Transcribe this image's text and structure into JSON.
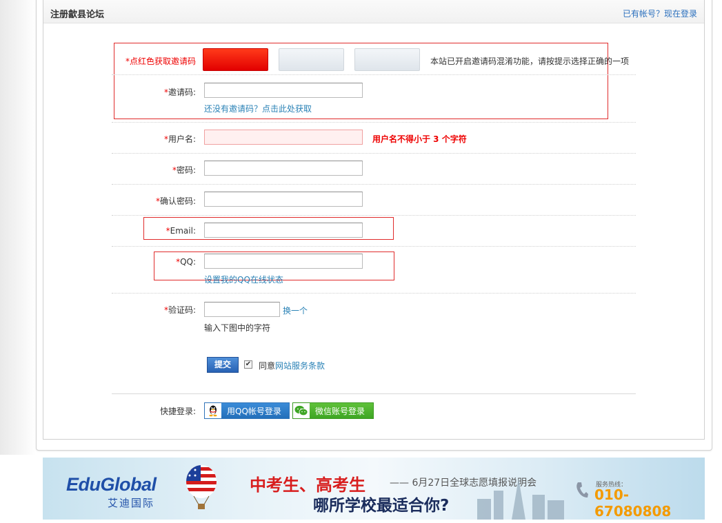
{
  "header": {
    "title": "注册歙县论坛",
    "login_link": "已有帐号？现在登录"
  },
  "invite": {
    "required_star": "*",
    "label": "点红色获取邀请码",
    "notice": "本站已开启邀请码混淆功能，请按提示选择正确的一项",
    "code_label": "邀请码:",
    "get_code_link": "还没有邀请码？点击此处获取"
  },
  "form": {
    "username_label": "用户名:",
    "username_error": "用户名不得小于 3 个字符",
    "password_label": "密码:",
    "confirm_password_label": "确认密码:",
    "email_label": "Email:",
    "qq_label": "QQ:",
    "qq_status_link": "设置我的QQ在线状态",
    "captcha_label": "验证码:",
    "captcha_refresh": "换一个",
    "captcha_hint": "输入下图中的字符",
    "submit_label": "提交",
    "agree_prefix": "同意",
    "agree_link": "网站服务条款",
    "agree_checked": true,
    "quick_login_label": "快捷登录:",
    "qq_login_label": "用QQ帐号登录",
    "wechat_login_label": "微信账号登录"
  },
  "banner": {
    "logo_text": "EduGlobal",
    "logo_cn": "艾迪国际",
    "headline": "中考生、高考生",
    "subline": "—— 6月27日全球志愿填报说明会",
    "question": "哪所学校最适合你?",
    "hotline_label": "服务热线：",
    "hotline_number": "010-67080808"
  },
  "colors": {
    "required": "#e00000",
    "link": "#2a82b6",
    "error": "#e00000",
    "highlight_box": "#e02a2a",
    "submit": "#2862b4",
    "qq_brand": "#236fba",
    "wechat_brand": "#3ea624"
  }
}
